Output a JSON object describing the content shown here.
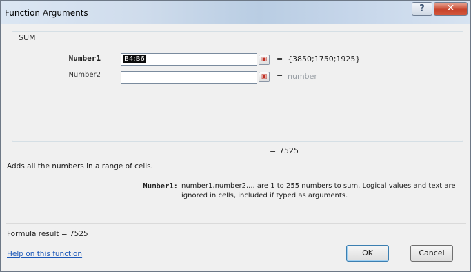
{
  "window": {
    "title": "Function Arguments",
    "help_glyph": "?",
    "close_glyph": "✕"
  },
  "function": {
    "name": "SUM",
    "args": [
      {
        "label": "Number1",
        "value": "B4:B6",
        "equals": "=",
        "result": "{3850;1750;1925}"
      },
      {
        "label": "Number2",
        "value": "",
        "equals": "=",
        "result": "number"
      }
    ],
    "total_equals": "=",
    "total_value": "7525",
    "description": "Adds all the numbers in a range of cells.",
    "arg_help_name": "Number1:",
    "arg_help_text": "number1,number2,... are 1 to 255 numbers to sum. Logical values and text are ignored in cells, included if typed as arguments."
  },
  "footer": {
    "formula_result_label": "Formula result =",
    "formula_result_value": "7525",
    "help_link": "Help on this function",
    "ok_label": "OK",
    "cancel_label": "Cancel"
  },
  "icons": {
    "collapse": "collapse-dialog-icon"
  },
  "colors": {
    "link": "#1c58b8",
    "close_button": "#c7422a"
  }
}
